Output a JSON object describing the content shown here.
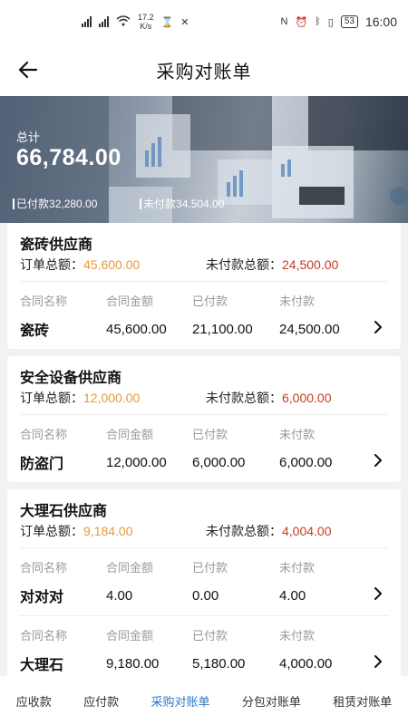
{
  "status_bar": {
    "speed_value": "17.2",
    "speed_unit": "K/s",
    "battery": "53",
    "time": "16:00"
  },
  "nav": {
    "title": "采购对账单"
  },
  "summary": {
    "total_label": "总计",
    "total_value": "66,784.00",
    "paid_label": "已付款",
    "paid_value": "32,280.00",
    "unpaid_label": "未付款",
    "unpaid_value": "34,504.00"
  },
  "labels": {
    "order_total": "订单总额：",
    "unpaid_total": "未付款总额：",
    "col_name": "合同名称",
    "col_amount": "合同金额",
    "col_paid": "已付款",
    "col_unpaid": "未付款"
  },
  "suppliers": [
    {
      "name": "瓷砖供应商",
      "order_total": "45,600.00",
      "unpaid_total": "24,500.00",
      "contracts": [
        {
          "name": "瓷砖",
          "amount": "45,600.00",
          "paid": "21,100.00",
          "unpaid": "24,500.00"
        }
      ]
    },
    {
      "name": "安全设备供应商",
      "order_total": "12,000.00",
      "unpaid_total": "6,000.00",
      "contracts": [
        {
          "name": "防盗门",
          "amount": "12,000.00",
          "paid": "6,000.00",
          "unpaid": "6,000.00"
        }
      ]
    },
    {
      "name": "大理石供应商",
      "order_total": "9,184.00",
      "unpaid_total": "4,004.00",
      "contracts": [
        {
          "name": "对对对",
          "amount": "4.00",
          "paid": "0.00",
          "unpaid": "4.00"
        },
        {
          "name": "大理石",
          "amount": "9,180.00",
          "paid": "5,180.00",
          "unpaid": "4,000.00"
        }
      ]
    }
  ],
  "tabs": [
    {
      "label": "应收款",
      "active": false
    },
    {
      "label": "应付款",
      "active": false
    },
    {
      "label": "采购对账单",
      "active": true
    },
    {
      "label": "分包对账单",
      "active": false
    },
    {
      "label": "租赁对账单",
      "active": false
    }
  ],
  "colors": {
    "accent": "#2e78c7",
    "order_amount": "#e8983b",
    "unpaid_amount": "#c83a22"
  }
}
